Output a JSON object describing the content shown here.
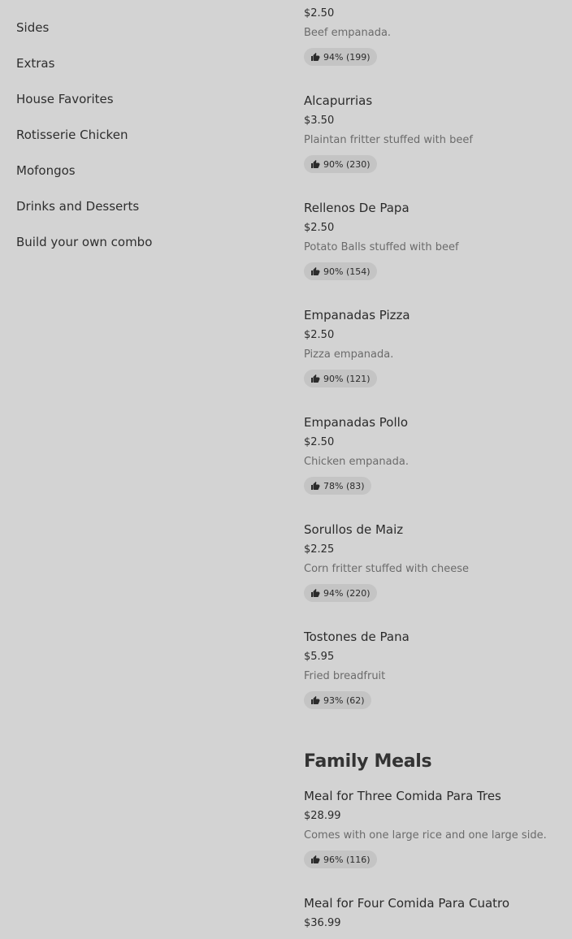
{
  "sidebar": {
    "items": [
      {
        "label": "Sides"
      },
      {
        "label": "Extras"
      },
      {
        "label": "House Favorites"
      },
      {
        "label": "Rotisserie Chicken"
      },
      {
        "label": "Mofongos"
      },
      {
        "label": "Drinks and Desserts"
      },
      {
        "label": "Build your own combo"
      }
    ]
  },
  "menu": {
    "top_item": {
      "price": "$2.50",
      "description": "Beef empanada.",
      "rating": "94% (199)"
    },
    "items": [
      {
        "name": "Alcapurrias",
        "price": "$3.50",
        "description": "Plaintan fritter stuffed with beef",
        "rating": "90% (230)"
      },
      {
        "name": "Rellenos De Papa",
        "price": "$2.50",
        "description": "Potato Balls stuffed with beef",
        "rating": "90% (154)"
      },
      {
        "name": "Empanadas Pizza",
        "price": "$2.50",
        "description": "Pizza empanada.",
        "rating": "90% (121)"
      },
      {
        "name": "Empanadas Pollo",
        "price": "$2.50",
        "description": "Chicken empanada.",
        "rating": "78% (83)"
      },
      {
        "name": "Sorullos de Maiz",
        "price": "$2.25",
        "description": "Corn fritter stuffed with cheese",
        "rating": "94% (220)"
      },
      {
        "name": "Tostones de Pana",
        "price": "$5.95",
        "description": "Fried breadfruit",
        "rating": "93% (62)"
      }
    ],
    "family_section": {
      "title": "Family Meals",
      "items": [
        {
          "name": "Meal for Three Comida Para Tres",
          "price": "$28.99",
          "description": "Comes with one large rice and one large side.",
          "rating": "96% (116)"
        },
        {
          "name": "Meal for Four Comida Para Cuatro",
          "price": "$36.99"
        }
      ]
    }
  },
  "icons": {
    "rating_icon": "thumbs-up-icon"
  }
}
